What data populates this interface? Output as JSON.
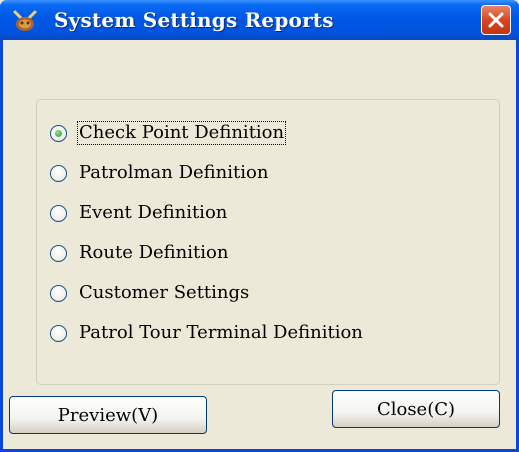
{
  "window": {
    "title": "System Settings Reports",
    "icon": "app-icon",
    "close_icon": "close-icon"
  },
  "options": [
    {
      "label": "Check Point Definition",
      "checked": true
    },
    {
      "label": "Patrolman Definition",
      "checked": false
    },
    {
      "label": "Event Definition",
      "checked": false
    },
    {
      "label": "Route Definition",
      "checked": false
    },
    {
      "label": "Customer Settings",
      "checked": false
    },
    {
      "label": "Patrol Tour Terminal Definition",
      "checked": false
    }
  ],
  "buttons": {
    "preview_label": "Preview(V)",
    "close_label": "Close(C)"
  },
  "colors": {
    "titlebar": "#0058e6",
    "close_button": "#d6411c",
    "dialog_bg": "#ece9d8",
    "radio_dot": "#21a121"
  }
}
